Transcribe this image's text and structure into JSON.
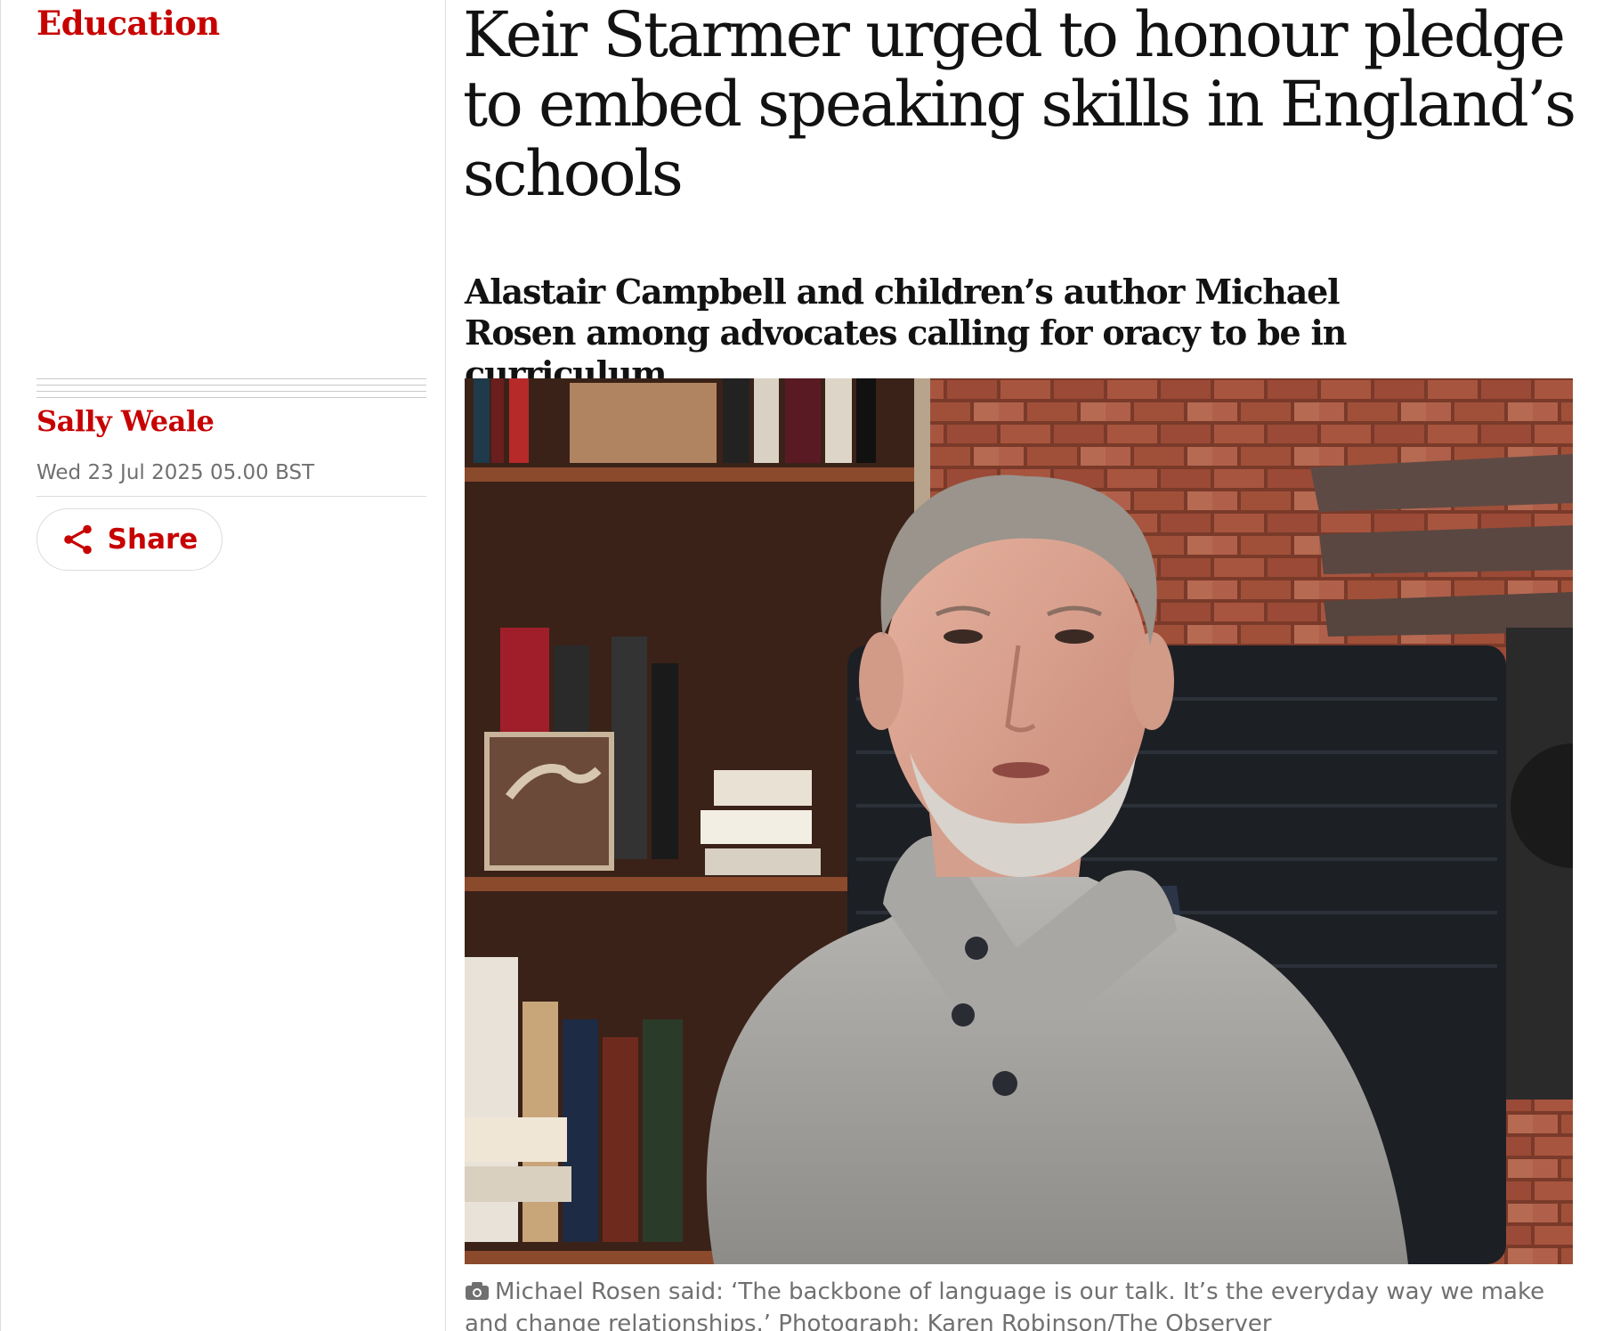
{
  "section": {
    "label": "Education"
  },
  "article": {
    "headline": "Keir Starmer urged to honour pledge to embed speaking skills in England’s schools",
    "standfirst": "Alastair Campbell and children’s author Michael Rosen among advocates calling for oracy to be in curriculum"
  },
  "byline": {
    "author": "Sally Weale",
    "date": "Wed 23 Jul 2025 05.00 BST"
  },
  "share": {
    "label": "Share",
    "icon": "share-icon"
  },
  "image": {
    "caption": "Michael Rosen said: ‘The backbone of language is our talk. It’s the everyday way we make and change relationships.’ Photograph: Karen Robinson/The Observer",
    "caption_icon": "camera-icon",
    "alt": "Michael Rosen seated in front of a bookshelf and brick wall"
  },
  "colors": {
    "accent": "#c70000",
    "text": "#121212",
    "muted": "#707070",
    "rule": "#dcdcdc"
  }
}
